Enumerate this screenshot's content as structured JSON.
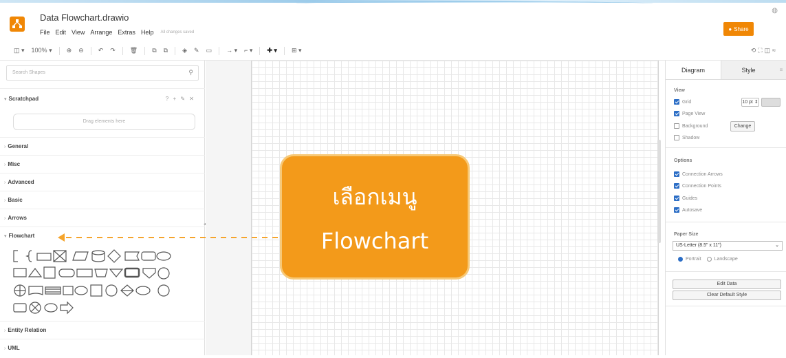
{
  "app": {
    "title": "Data Flowchart.drawio",
    "menu": [
      "File",
      "Edit",
      "View",
      "Arrange",
      "Extras",
      "Help"
    ],
    "saved_status": "All changes saved",
    "share_label": "Share"
  },
  "toolbar": {
    "zoom": "100%"
  },
  "left_panel": {
    "search_placeholder": "Search Shapes",
    "scratchpad_label": "Scratchpad",
    "scratchpad_actions": "? + ✎ ✕",
    "drag_hint": "Drag elements here",
    "sections": [
      "General",
      "Misc",
      "Advanced",
      "Basic",
      "Arrows",
      "Flowchart",
      "Entity Relation",
      "UML"
    ]
  },
  "callout": {
    "line1": "เลือกเมนู",
    "line2": "Flowchart",
    "color": "#f39a1a"
  },
  "right_panel": {
    "tabs": [
      "Diagram",
      "Style"
    ],
    "view_label": "View",
    "grid_label": "Grid",
    "grid_size": "10 pt",
    "page_view_label": "Page View",
    "background_label": "Background",
    "change_label": "Change",
    "shadow_label": "Shadow",
    "options_label": "Options",
    "options": [
      "Connection Arrows",
      "Connection Points",
      "Guides",
      "Autosave"
    ],
    "paper_size_label": "Paper Size",
    "paper_size_value": "US-Letter (8.5\" x 11\")",
    "portrait_label": "Portrait",
    "landscape_label": "Landscape",
    "edit_data_label": "Edit Data",
    "clear_style_label": "Clear Default Style"
  }
}
